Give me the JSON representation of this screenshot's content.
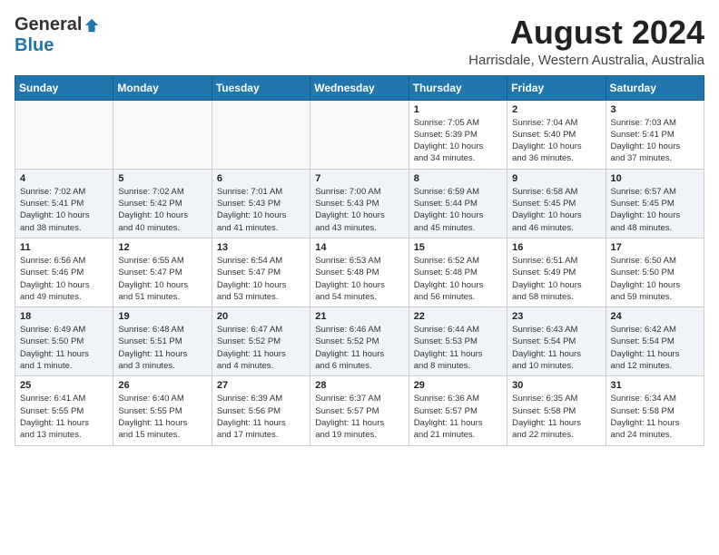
{
  "logo": {
    "general": "General",
    "blue": "Blue"
  },
  "title": "August 2024",
  "subtitle": "Harrisdale, Western Australia, Australia",
  "days_of_week": [
    "Sunday",
    "Monday",
    "Tuesday",
    "Wednesday",
    "Thursday",
    "Friday",
    "Saturday"
  ],
  "weeks": [
    [
      {
        "day": "",
        "info": ""
      },
      {
        "day": "",
        "info": ""
      },
      {
        "day": "",
        "info": ""
      },
      {
        "day": "",
        "info": ""
      },
      {
        "day": "1",
        "info": "Sunrise: 7:05 AM\nSunset: 5:39 PM\nDaylight: 10 hours\nand 34 minutes."
      },
      {
        "day": "2",
        "info": "Sunrise: 7:04 AM\nSunset: 5:40 PM\nDaylight: 10 hours\nand 36 minutes."
      },
      {
        "day": "3",
        "info": "Sunrise: 7:03 AM\nSunset: 5:41 PM\nDaylight: 10 hours\nand 37 minutes."
      }
    ],
    [
      {
        "day": "4",
        "info": "Sunrise: 7:02 AM\nSunset: 5:41 PM\nDaylight: 10 hours\nand 38 minutes."
      },
      {
        "day": "5",
        "info": "Sunrise: 7:02 AM\nSunset: 5:42 PM\nDaylight: 10 hours\nand 40 minutes."
      },
      {
        "day": "6",
        "info": "Sunrise: 7:01 AM\nSunset: 5:43 PM\nDaylight: 10 hours\nand 41 minutes."
      },
      {
        "day": "7",
        "info": "Sunrise: 7:00 AM\nSunset: 5:43 PM\nDaylight: 10 hours\nand 43 minutes."
      },
      {
        "day": "8",
        "info": "Sunrise: 6:59 AM\nSunset: 5:44 PM\nDaylight: 10 hours\nand 45 minutes."
      },
      {
        "day": "9",
        "info": "Sunrise: 6:58 AM\nSunset: 5:45 PM\nDaylight: 10 hours\nand 46 minutes."
      },
      {
        "day": "10",
        "info": "Sunrise: 6:57 AM\nSunset: 5:45 PM\nDaylight: 10 hours\nand 48 minutes."
      }
    ],
    [
      {
        "day": "11",
        "info": "Sunrise: 6:56 AM\nSunset: 5:46 PM\nDaylight: 10 hours\nand 49 minutes."
      },
      {
        "day": "12",
        "info": "Sunrise: 6:55 AM\nSunset: 5:47 PM\nDaylight: 10 hours\nand 51 minutes."
      },
      {
        "day": "13",
        "info": "Sunrise: 6:54 AM\nSunset: 5:47 PM\nDaylight: 10 hours\nand 53 minutes."
      },
      {
        "day": "14",
        "info": "Sunrise: 6:53 AM\nSunset: 5:48 PM\nDaylight: 10 hours\nand 54 minutes."
      },
      {
        "day": "15",
        "info": "Sunrise: 6:52 AM\nSunset: 5:48 PM\nDaylight: 10 hours\nand 56 minutes."
      },
      {
        "day": "16",
        "info": "Sunrise: 6:51 AM\nSunset: 5:49 PM\nDaylight: 10 hours\nand 58 minutes."
      },
      {
        "day": "17",
        "info": "Sunrise: 6:50 AM\nSunset: 5:50 PM\nDaylight: 10 hours\nand 59 minutes."
      }
    ],
    [
      {
        "day": "18",
        "info": "Sunrise: 6:49 AM\nSunset: 5:50 PM\nDaylight: 11 hours\nand 1 minute."
      },
      {
        "day": "19",
        "info": "Sunrise: 6:48 AM\nSunset: 5:51 PM\nDaylight: 11 hours\nand 3 minutes."
      },
      {
        "day": "20",
        "info": "Sunrise: 6:47 AM\nSunset: 5:52 PM\nDaylight: 11 hours\nand 4 minutes."
      },
      {
        "day": "21",
        "info": "Sunrise: 6:46 AM\nSunset: 5:52 PM\nDaylight: 11 hours\nand 6 minutes."
      },
      {
        "day": "22",
        "info": "Sunrise: 6:44 AM\nSunset: 5:53 PM\nDaylight: 11 hours\nand 8 minutes."
      },
      {
        "day": "23",
        "info": "Sunrise: 6:43 AM\nSunset: 5:54 PM\nDaylight: 11 hours\nand 10 minutes."
      },
      {
        "day": "24",
        "info": "Sunrise: 6:42 AM\nSunset: 5:54 PM\nDaylight: 11 hours\nand 12 minutes."
      }
    ],
    [
      {
        "day": "25",
        "info": "Sunrise: 6:41 AM\nSunset: 5:55 PM\nDaylight: 11 hours\nand 13 minutes."
      },
      {
        "day": "26",
        "info": "Sunrise: 6:40 AM\nSunset: 5:55 PM\nDaylight: 11 hours\nand 15 minutes."
      },
      {
        "day": "27",
        "info": "Sunrise: 6:39 AM\nSunset: 5:56 PM\nDaylight: 11 hours\nand 17 minutes."
      },
      {
        "day": "28",
        "info": "Sunrise: 6:37 AM\nSunset: 5:57 PM\nDaylight: 11 hours\nand 19 minutes."
      },
      {
        "day": "29",
        "info": "Sunrise: 6:36 AM\nSunset: 5:57 PM\nDaylight: 11 hours\nand 21 minutes."
      },
      {
        "day": "30",
        "info": "Sunrise: 6:35 AM\nSunset: 5:58 PM\nDaylight: 11 hours\nand 22 minutes."
      },
      {
        "day": "31",
        "info": "Sunrise: 6:34 AM\nSunset: 5:58 PM\nDaylight: 11 hours\nand 24 minutes."
      }
    ]
  ]
}
